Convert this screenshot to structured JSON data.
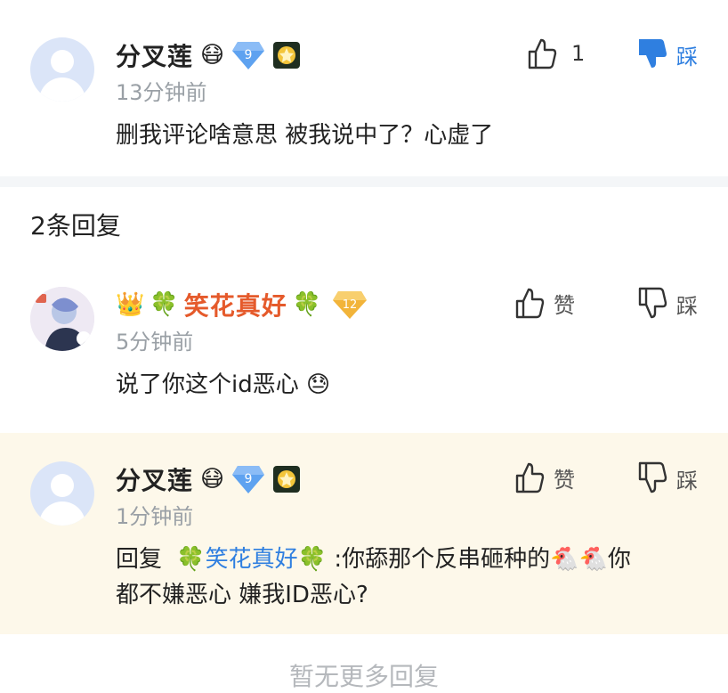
{
  "top_comment": {
    "username": "分叉莲",
    "face_emoji": "😷",
    "level": "9",
    "time": "13分钟前",
    "text": "删我评论啥意思 被我说中了？心虚了",
    "like_count": "1",
    "dislike_label": "踩"
  },
  "reply_count": "2条回复",
  "reply1": {
    "crown_emoji": "👑",
    "clover_emoji": "🍀",
    "username": "笑花真好",
    "level": "12",
    "time": "5分钟前",
    "text": "说了你这个id恶心",
    "text_emoji": "😓",
    "like_label": "赞",
    "dislike_label": "踩"
  },
  "reply2": {
    "username": "分叉莲",
    "face_emoji": "😷",
    "level": "9",
    "time": "1分钟前",
    "text_prefix": "回复",
    "mention": "笑花真好",
    "text_line1": ":你舔那个反串砸种的",
    "chicken_emoji": "🐔",
    "text_line1_end": "你",
    "text_line2": "都不嫌恶心 嫌我ID恶心?",
    "like_label": "赞",
    "dislike_label": "踩"
  },
  "footer": "暂无更多回复",
  "colors": {
    "blue": "#2f7fe0",
    "orange_name": "#e55a2b",
    "highlight_bg": "#fdf8ea",
    "gray_text": "#9aa0a6"
  }
}
